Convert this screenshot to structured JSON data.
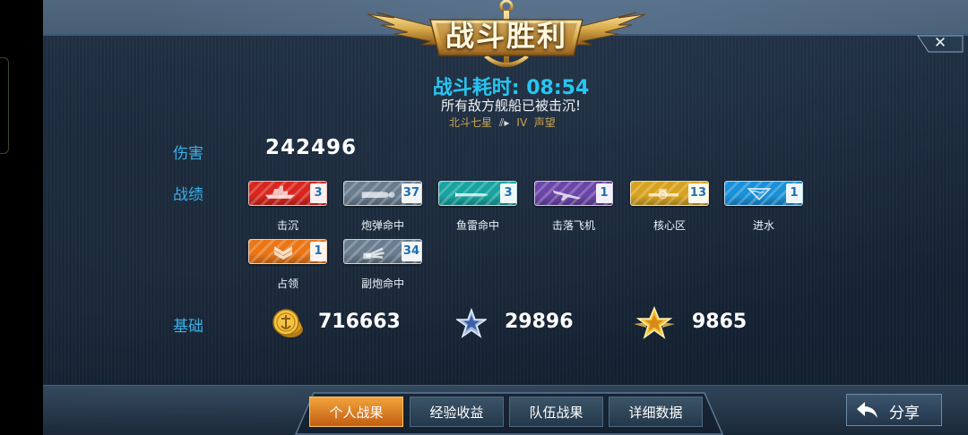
{
  "banner": {
    "title": "战斗胜利"
  },
  "close": {
    "glyph": "✕"
  },
  "battle": {
    "duration_label": "战斗耗时:",
    "duration_value": "08:54",
    "result_text": "所有敌方舰船已被击沉!",
    "ship_name": "北斗七星",
    "tier": "IV",
    "reputation": "声望"
  },
  "stats": {
    "damage_label": "伤害",
    "damage_value": "242496",
    "achievements_label": "战绩",
    "badges": [
      {
        "caption": "击沉",
        "count": "3",
        "color": "#d8261e",
        "icon": "sinking-ship-icon"
      },
      {
        "caption": "炮弹命中",
        "count": "37",
        "color": "#6a7d90",
        "icon": "shell-hit-icon"
      },
      {
        "caption": "鱼雷命中",
        "count": "3",
        "color": "#17a3a0",
        "icon": "torpedo-hit-icon"
      },
      {
        "caption": "击落飞机",
        "count": "1",
        "color": "#6b45a8",
        "icon": "plane-shootdown-icon"
      },
      {
        "caption": "核心区",
        "count": "13",
        "color": "#d7a21e",
        "icon": "citadel-hit-icon"
      },
      {
        "caption": "进水",
        "count": "1",
        "color": "#1990d8",
        "icon": "flooding-icon"
      },
      {
        "caption": "占领",
        "count": "1",
        "color": "#ea7616",
        "icon": "capture-icon"
      },
      {
        "caption": "副炮命中",
        "count": "34",
        "color": "#6a7d90",
        "icon": "secondary-hit-icon"
      }
    ],
    "base_label": "基础",
    "currencies": [
      {
        "icon": "gold-coin-icon",
        "value": "716663"
      },
      {
        "icon": "silver-star-icon",
        "value": "29896"
      },
      {
        "icon": "gold-star-icon",
        "value": "9865"
      }
    ]
  },
  "tabs": [
    {
      "label": "个人战果",
      "active": true
    },
    {
      "label": "经验收益",
      "active": false
    },
    {
      "label": "队伍战果",
      "active": false
    },
    {
      "label": "详细数据",
      "active": false
    }
  ],
  "share": {
    "label": "分享"
  }
}
